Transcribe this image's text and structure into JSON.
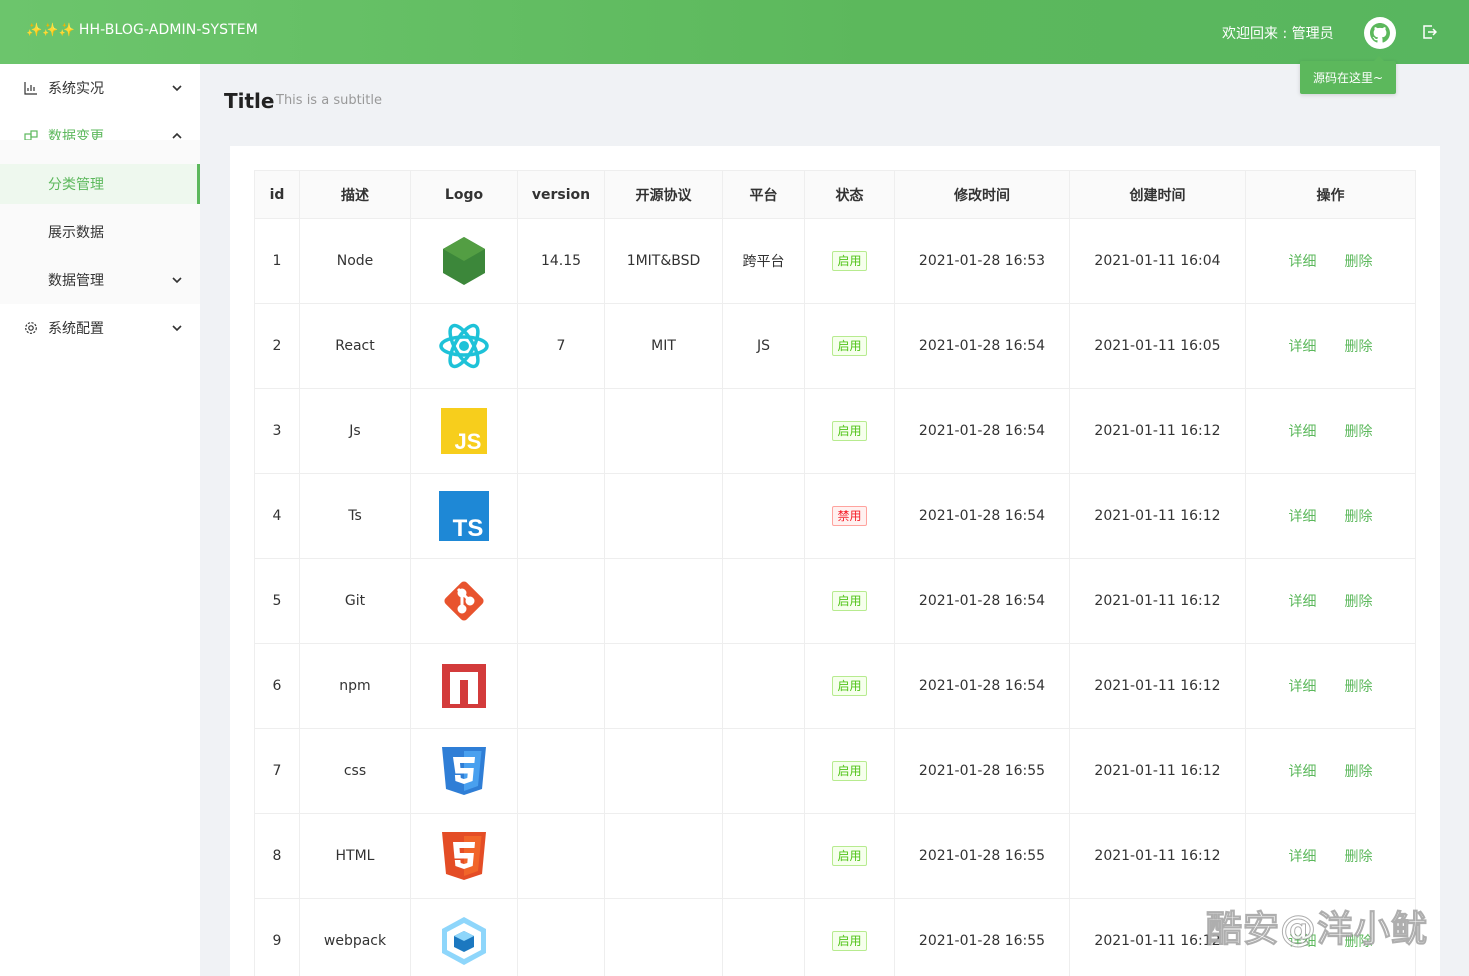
{
  "header": {
    "brand_stars": "✨✨✨",
    "brand_title": "HH-BLOG-ADMIN-SYSTEM",
    "welcome": "欢迎回来 : 管理员",
    "tooltip": "源码在这里~"
  },
  "sidebar": {
    "items": [
      {
        "label": "系统实况",
        "icon": "chart-icon"
      },
      {
        "label": "数据变更",
        "icon": "data-change-icon"
      },
      {
        "label": "系统配置",
        "icon": "gear-icon"
      }
    ],
    "sub_items": [
      {
        "label": "分类管理"
      },
      {
        "label": "展示数据"
      },
      {
        "label": "数据管理"
      }
    ]
  },
  "page": {
    "title": "Title",
    "subtitle": "This is a subtitle"
  },
  "table": {
    "headers": [
      "id",
      "描述",
      "Logo",
      "version",
      "开源协议",
      "平台",
      "状态",
      "修改时间",
      "创建时间",
      "操作"
    ],
    "rows": [
      {
        "id": "1",
        "desc": "Node",
        "logo": "node-logo",
        "version": "14.15",
        "license": "1MIT&BSD",
        "platform": "跨平台",
        "status": "启用",
        "modified": "2021-01-28 16:53",
        "created": "2021-01-11 16:04"
      },
      {
        "id": "2",
        "desc": "React",
        "logo": "react-logo",
        "version": "7",
        "license": "MIT",
        "platform": "JS",
        "status": "启用",
        "modified": "2021-01-28 16:54",
        "created": "2021-01-11 16:05"
      },
      {
        "id": "3",
        "desc": "Js",
        "logo": "js-logo",
        "version": "",
        "license": "",
        "platform": "",
        "status": "启用",
        "modified": "2021-01-28 16:54",
        "created": "2021-01-11 16:12"
      },
      {
        "id": "4",
        "desc": "Ts",
        "logo": "ts-logo",
        "version": "",
        "license": "",
        "platform": "",
        "status": "禁用",
        "modified": "2021-01-28 16:54",
        "created": "2021-01-11 16:12"
      },
      {
        "id": "5",
        "desc": "Git",
        "logo": "git-logo",
        "version": "",
        "license": "",
        "platform": "",
        "status": "启用",
        "modified": "2021-01-28 16:54",
        "created": "2021-01-11 16:12"
      },
      {
        "id": "6",
        "desc": "npm",
        "logo": "npm-logo",
        "version": "",
        "license": "",
        "platform": "",
        "status": "启用",
        "modified": "2021-01-28 16:54",
        "created": "2021-01-11 16:12"
      },
      {
        "id": "7",
        "desc": "css",
        "logo": "css-logo",
        "version": "",
        "license": "",
        "platform": "",
        "status": "启用",
        "modified": "2021-01-28 16:55",
        "created": "2021-01-11 16:12"
      },
      {
        "id": "8",
        "desc": "HTML",
        "logo": "html-logo",
        "version": "",
        "license": "",
        "platform": "",
        "status": "启用",
        "modified": "2021-01-28 16:55",
        "created": "2021-01-11 16:12"
      },
      {
        "id": "9",
        "desc": "webpack",
        "logo": "webpack-logo",
        "version": "",
        "license": "",
        "platform": "",
        "status": "启用",
        "modified": "2021-01-28 16:55",
        "created": "2021-01-11 16:12"
      }
    ],
    "action_detail": "详细",
    "action_delete": "删除"
  },
  "watermark": "酷安@洋小鱿",
  "colors": {
    "primary": "#5cb85c",
    "danger": "#f5222d"
  }
}
